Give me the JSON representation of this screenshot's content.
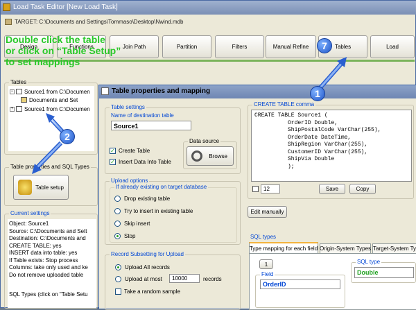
{
  "window": {
    "title": "Load Task Editor [New Load Task]",
    "target_path": "TARGET: C:\\Documents and Settings\\Tommaso\\Desktop\\Nwind.mdb"
  },
  "steps": [
    "Design",
    "Functions",
    "Join Path",
    "Partition",
    "Filters",
    "Manual Refine",
    "Tables",
    "Load"
  ],
  "guide_text": [
    "Double click the table",
    "or click on “Table Setup”",
    "to set mappings"
  ],
  "tables_panel": {
    "title": "Tables",
    "items": [
      "Source1 from C:\\Documen",
      "Documents and Set",
      "Source1 from C:\\Documen"
    ]
  },
  "table_sql_panel": {
    "title": "Table properties and SQL Types",
    "button": "Table setup"
  },
  "current_settings": {
    "title": "Current settings",
    "lines": [
      "Object: Source1",
      "Source: C:\\Documents and Sett",
      "Destination: C:\\Documents and",
      "CREATE TABLE: yes",
      "INSERT data into table: yes",
      "If Table exists: Stop process",
      "Columns: take only used and ke",
      "Do not remove uploaded table"
    ],
    "footer": "SQL Types (click on \"Table Setu"
  },
  "dialog": {
    "title": "Table properties and mapping",
    "table_settings": {
      "title": "Table settings",
      "name_label": "Name of destination table",
      "name_value": "Source1",
      "create_table": "Create Table",
      "insert_data": "Insert Data Into Table",
      "data_source_title": "Data source",
      "browse": "Browse"
    },
    "upload_options": {
      "title": "Upload options",
      "subtitle": "If already existing on target database",
      "options": [
        "Drop existing table",
        "Try to insert in existing table",
        "Skip insert",
        "Stop"
      ],
      "selected": "Stop"
    },
    "subsetting": {
      "title": "Record Subsetting for Upload",
      "upload_all": "Upload All records",
      "upload_at_most": "Upload at most",
      "at_most_value": "10000",
      "records": "records",
      "random_sample": "Take a random sample"
    },
    "create_table_panel": {
      "title": "CREATE TABLE comma",
      "sql": "CREATE TABLE Source1 (\n          OrderID Double,\n          ShipPostalCode VarChar(255),\n          OrderDate DateTime,\n          ShipRegion VarChar(255),\n          CustomerID VarChar(255),\n          ShipVia Double\n          );",
      "font_size": "12",
      "save": "Save",
      "copy": "Copy"
    },
    "edit_manually": "Edit manually",
    "sql_types": {
      "title": "SQL types",
      "tabs": [
        "Type mapping for each field",
        "Origin-System Types",
        "Target-System Ty"
      ],
      "page": "1",
      "field_label": "Field",
      "field_value": "OrderID",
      "sql_type_label": "SQL type",
      "sql_type_value": "Double"
    }
  },
  "callouts": [
    "1",
    "2",
    "7"
  ],
  "colors": {
    "guide_green": "#28c828",
    "callout_blue": "#1e54c8",
    "accent_blue": "#0046d5"
  }
}
